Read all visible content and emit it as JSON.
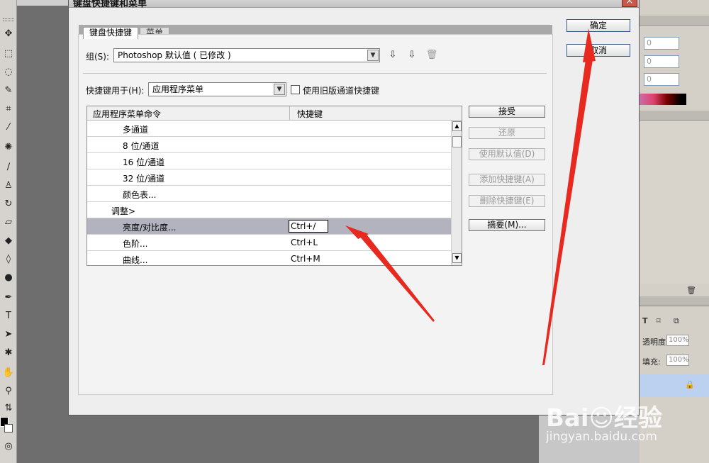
{
  "dialog": {
    "title": "键盘快捷键和菜单",
    "close_icon": "×",
    "ok_label": "确定",
    "cancel_label": "取消"
  },
  "tabs": [
    {
      "label": "键盘快捷键",
      "active": true
    },
    {
      "label": "菜单",
      "active": false
    }
  ],
  "set": {
    "label": "组(S):",
    "value": "Photoshop 默认值 ( 已修改 )"
  },
  "shortcuts_for": {
    "label": "快捷键用于(H):",
    "value": "应用程序菜单"
  },
  "legacy_checkbox": {
    "label": "使用旧版通道快捷键",
    "checked": false
  },
  "table": {
    "columns": [
      "应用程序菜单命令",
      "快捷键"
    ],
    "rows": [
      {
        "command": "多通道",
        "shortcut": "",
        "indent": 2
      },
      {
        "command": "8 位/通道",
        "shortcut": "",
        "indent": 2
      },
      {
        "command": "16 位/通道",
        "shortcut": "",
        "indent": 2
      },
      {
        "command": "32 位/通道",
        "shortcut": "",
        "indent": 2
      },
      {
        "command": "颜色表...",
        "shortcut": "",
        "indent": 2
      },
      {
        "command": "调整>",
        "shortcut": "",
        "indent": 1
      },
      {
        "command": "亮度/对比度...",
        "shortcut": "Ctrl+/",
        "indent": 2,
        "selected": true
      },
      {
        "command": "色阶...",
        "shortcut": "Ctrl+L",
        "indent": 2
      },
      {
        "command": "曲线...",
        "shortcut": "Ctrl+M",
        "indent": 2
      }
    ]
  },
  "side_buttons": [
    {
      "label": "接受",
      "enabled": true
    },
    {
      "label": "还原",
      "enabled": false
    },
    {
      "label": "使用默认值(D)",
      "enabled": false
    },
    {
      "label": "添加快捷键(A)",
      "enabled": false
    },
    {
      "label": "删除快捷键(E)",
      "enabled": false
    },
    {
      "label": "摘要(M)...",
      "enabled": true
    }
  ],
  "right_panel": {
    "inputs": [
      "0",
      "0",
      "0"
    ],
    "opacity_label": "透明度:",
    "opacity_value": "100%",
    "fill_label": "填充:",
    "fill_value": "100%"
  },
  "watermark": {
    "brand": "Bai☺经验",
    "url": "jingyan.baidu.com"
  },
  "colors": {
    "arrow": "#e8291f",
    "selection": "#b3b3bf"
  }
}
